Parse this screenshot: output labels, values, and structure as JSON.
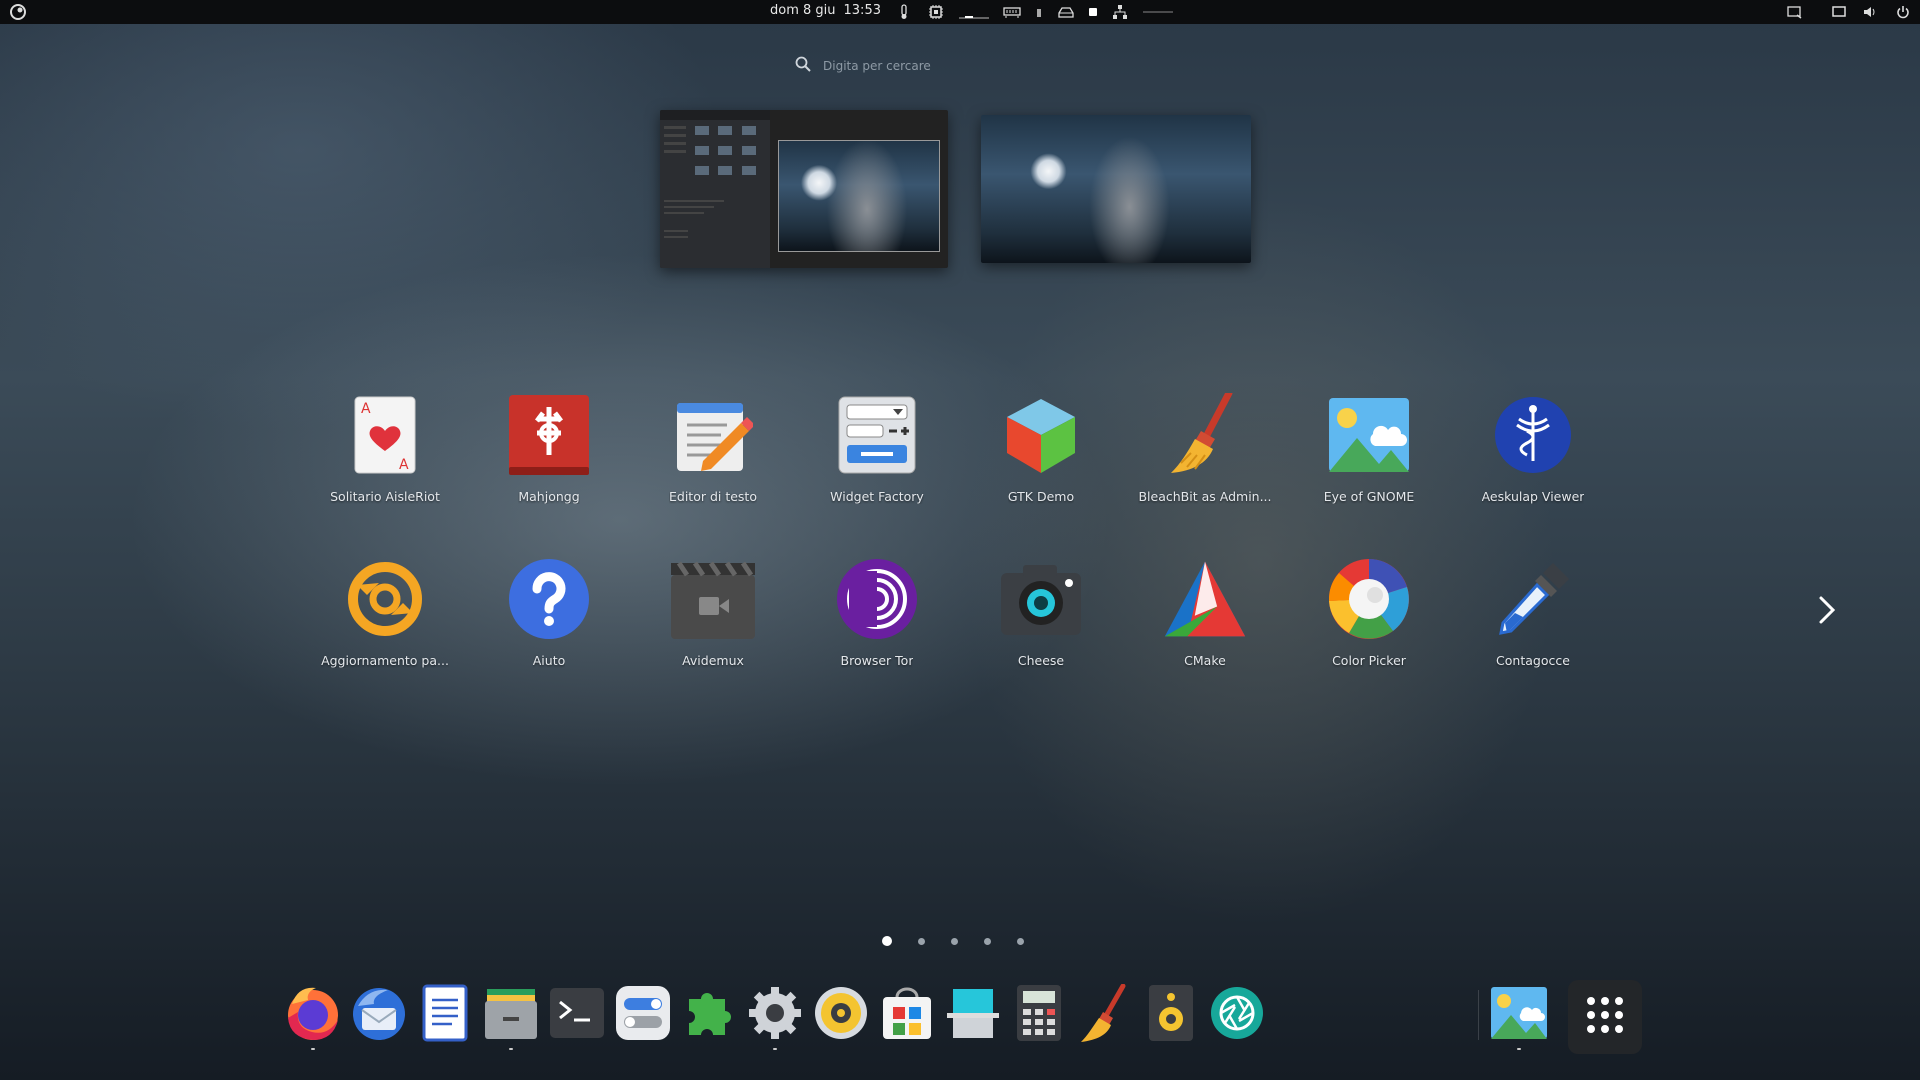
{
  "topbar": {
    "date": "dom 8 giu",
    "time": "13:53",
    "icons": [
      "activities-logo-icon",
      "thermometer-icon",
      "cpu-icon",
      "ram-icon",
      "storage-icon",
      "network-icon",
      "screenshot-icon",
      "display-icon",
      "volume-icon",
      "power-icon"
    ]
  },
  "search": {
    "placeholder": "Digita per cercare"
  },
  "workspaces": [
    {
      "name": "workspace-1"
    },
    {
      "name": "workspace-2"
    }
  ],
  "apps": [
    {
      "label": "Solitario AisleRiot",
      "icon": "solitaire-icon"
    },
    {
      "label": "Mahjongg",
      "icon": "mahjongg-icon"
    },
    {
      "label": "Editor di testo",
      "icon": "text-editor-icon"
    },
    {
      "label": "Widget Factory",
      "icon": "widget-factory-icon"
    },
    {
      "label": "GTK Demo",
      "icon": "gtk-demo-icon"
    },
    {
      "label": "BleachBit as Admin...",
      "icon": "bleachbit-icon"
    },
    {
      "label": "Eye of GNOME",
      "icon": "image-viewer-icon"
    },
    {
      "label": "Aeskulap Viewer",
      "icon": "aeskulap-icon"
    },
    {
      "label": "Aggiornamento pa...",
      "icon": "software-update-icon"
    },
    {
      "label": "Aiuto",
      "icon": "help-icon"
    },
    {
      "label": "Avidemux",
      "icon": "avidemux-icon"
    },
    {
      "label": "Browser Tor",
      "icon": "tor-browser-icon"
    },
    {
      "label": "Cheese",
      "icon": "cheese-camera-icon"
    },
    {
      "label": "CMake",
      "icon": "cmake-icon"
    },
    {
      "label": "Color Picker",
      "icon": "color-picker-icon"
    },
    {
      "label": "Contagocce",
      "icon": "eyedropper-icon"
    }
  ],
  "pagination": {
    "pages": 5,
    "current": 1
  },
  "dock": [
    {
      "name": "firefox-icon",
      "running": true
    },
    {
      "name": "thunderbird-icon",
      "running": false
    },
    {
      "name": "document-writer-icon",
      "running": false
    },
    {
      "name": "file-manager-icon",
      "running": true
    },
    {
      "name": "terminal-icon",
      "running": false
    },
    {
      "name": "tweaks-icon",
      "running": false
    },
    {
      "name": "extensions-icon",
      "running": false
    },
    {
      "name": "settings-gear-icon",
      "running": true
    },
    {
      "name": "music-player-icon",
      "running": false
    },
    {
      "name": "software-store-icon",
      "running": false
    },
    {
      "name": "scanner-icon",
      "running": false
    },
    {
      "name": "calculator-icon",
      "running": false
    },
    {
      "name": "bleachbit-icon",
      "running": false
    },
    {
      "name": "speaker-icon",
      "running": false
    },
    {
      "name": "aperture-icon",
      "running": false
    },
    {
      "name": "image-viewer-icon",
      "running": true
    }
  ],
  "colors": {
    "topbar": "#0c0d0f",
    "accent": "#3584e4"
  }
}
